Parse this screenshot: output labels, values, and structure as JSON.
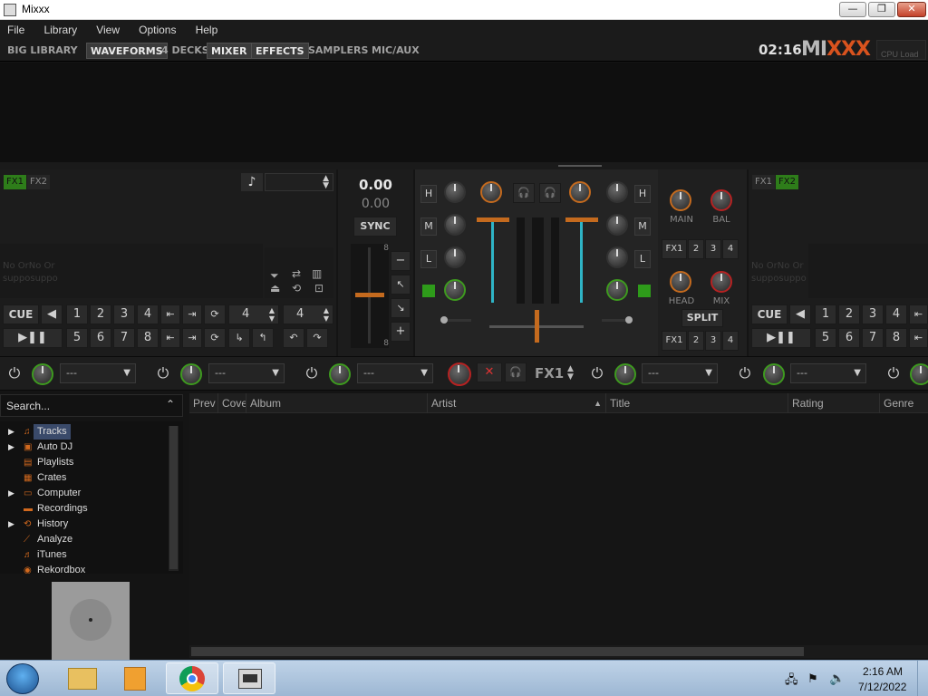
{
  "window": {
    "title": "Mixxx",
    "min": "—",
    "max": "❐",
    "close": "✕"
  },
  "menu": [
    "File",
    "Library",
    "View",
    "Options",
    "Help"
  ],
  "toolbar": {
    "buttons": [
      {
        "label": "BIG LIBRARY",
        "on": false
      },
      {
        "label": "WAVEFORMS",
        "on": true
      },
      {
        "label": "4 DECKS",
        "on": false
      },
      {
        "label": "MIXER",
        "on": true
      },
      {
        "label": "EFFECTS",
        "on": true
      },
      {
        "label": "SAMPLERS",
        "on": false
      },
      {
        "label": "MIC/AUX",
        "on": false
      }
    ],
    "clock": "02:16",
    "logo": "MIXXX",
    "cpu_label": "CPU Load"
  },
  "deck1": {
    "fx1": "FX1",
    "fx2": "FX2",
    "note_icon": "♪",
    "not_loaded": "No OrNo Or supposuppo",
    "cue": "CUE",
    "hotcues_top": [
      "1",
      "2",
      "3",
      "4"
    ],
    "hotcues_bottom": [
      "5",
      "6",
      "7",
      "8"
    ],
    "loop_size_1": "4",
    "loop_size_2": "4",
    "play": "▶❚❚"
  },
  "deck2": {
    "fx1": "FX1",
    "fx2": "FX2",
    "not_loaded": "No OrNo Or supposuppo",
    "cue": "CUE",
    "hotcues_top": [
      "1",
      "2",
      "3",
      "4"
    ],
    "hotcues_bottom": [
      "5",
      "6",
      "7",
      "8"
    ],
    "play": "▶❚❚"
  },
  "tempo": {
    "rate": "0.00",
    "bpm": "0.00",
    "sync": "SYNC",
    "scale_top": "8",
    "scale_bottom": "8"
  },
  "mixer": {
    "high": "H",
    "mid": "M",
    "low": "L"
  },
  "master": {
    "main": "MAIN",
    "bal": "BAL",
    "head": "HEAD",
    "mix": "MIX",
    "split": "SPLIT",
    "fx_assign": [
      "FX1",
      "2",
      "3",
      "4"
    ]
  },
  "effects": {
    "unit_label": "FX1",
    "combo_value": "---"
  },
  "library": {
    "search_placeholder": "Search...",
    "tree": [
      {
        "label": "Tracks",
        "icon": "♫",
        "expandable": true,
        "selected": true
      },
      {
        "label": "Auto DJ",
        "icon": "▣",
        "expandable": true,
        "selected": false
      },
      {
        "label": "Playlists",
        "icon": "▤",
        "expandable": false,
        "selected": false
      },
      {
        "label": "Crates",
        "icon": "▦",
        "expandable": false,
        "selected": false
      },
      {
        "label": "Computer",
        "icon": "▭",
        "expandable": true,
        "selected": false
      },
      {
        "label": "Recordings",
        "icon": "▬",
        "expandable": false,
        "selected": false
      },
      {
        "label": "History",
        "icon": "⟲",
        "expandable": true,
        "selected": false
      },
      {
        "label": "Analyze",
        "icon": "⟋",
        "expandable": false,
        "selected": false
      },
      {
        "label": "iTunes",
        "icon": "♬",
        "expandable": false,
        "selected": false
      },
      {
        "label": "Rekordbox",
        "icon": "◉",
        "expandable": false,
        "selected": false
      }
    ],
    "columns": [
      "Prev",
      "Cove",
      "Album",
      "Artist",
      "Title",
      "Rating",
      "Genre"
    ],
    "sort_indicator": "▲"
  },
  "taskbar": {
    "time": "2:16 AM",
    "date": "7/12/2022"
  }
}
